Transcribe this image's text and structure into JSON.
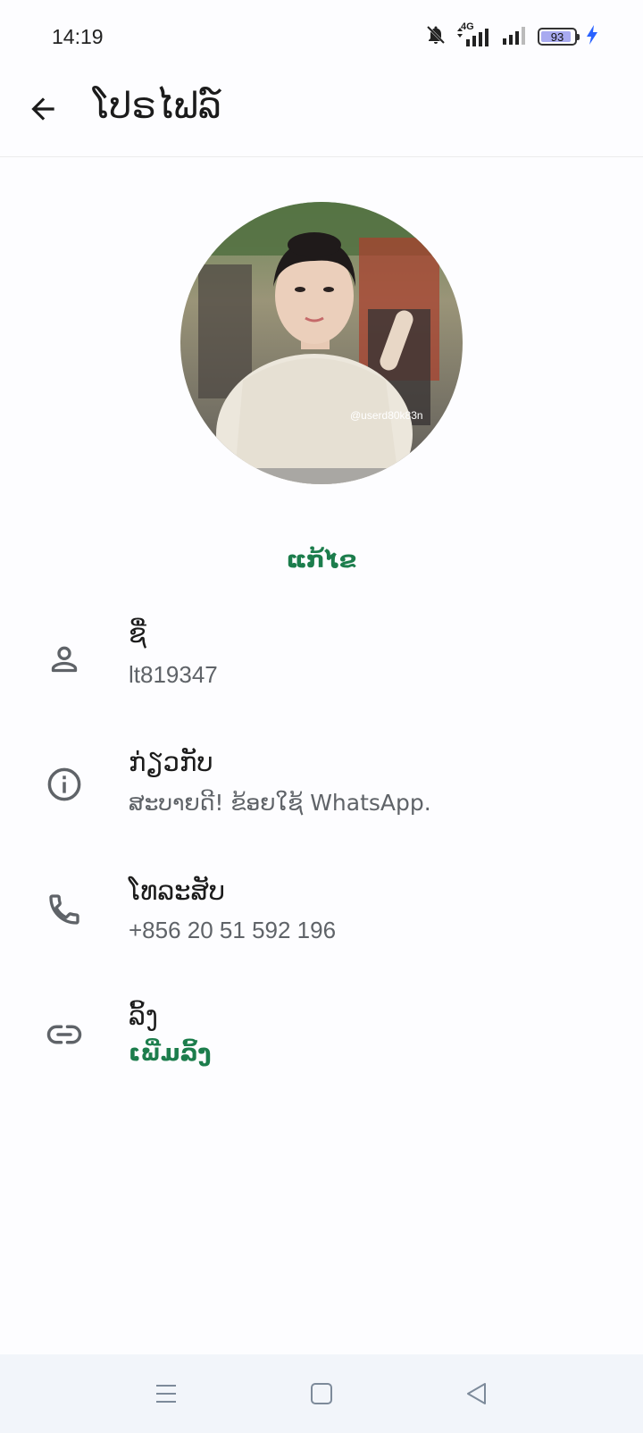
{
  "status_bar": {
    "time": "14:19",
    "network": "4G",
    "battery_percent": "93",
    "battery_level": 0.93,
    "icons": [
      "notifications-off-icon",
      "signal-icon",
      "signal-icon",
      "battery-icon",
      "charging-bolt-icon"
    ]
  },
  "app_bar": {
    "title": "ໂປຣໄຟລ໌",
    "back_icon": "arrow-back-icon"
  },
  "profile": {
    "avatar_watermark": "@userd80k83n",
    "edit_label": "ແກ້ໄຂ"
  },
  "rows": [
    {
      "icon": "person-icon",
      "label": "ຊື່",
      "value": "lt819347"
    },
    {
      "icon": "info-icon",
      "label": "ກ່ຽວກັບ",
      "value": "ສະບາຍດີ! ຂ້ອຍໃຊ້ WhatsApp."
    },
    {
      "icon": "phone-icon",
      "label": "ໂທລະສັບ",
      "value": "+856 20 51 592 196"
    },
    {
      "icon": "link-icon",
      "label": "ລິ້ງ",
      "value": "ເພີ່ມລິ້ງ"
    }
  ],
  "colors": {
    "accent": "#1c7d4c",
    "secondary_text": "#5f6368",
    "nav_background": "#f2f5fa",
    "battery_fill": "#a8aaf0",
    "charging": "#2962ff"
  },
  "nav_bar": {
    "icons": [
      "menu-icon",
      "home-icon",
      "back-triangle-icon"
    ]
  }
}
